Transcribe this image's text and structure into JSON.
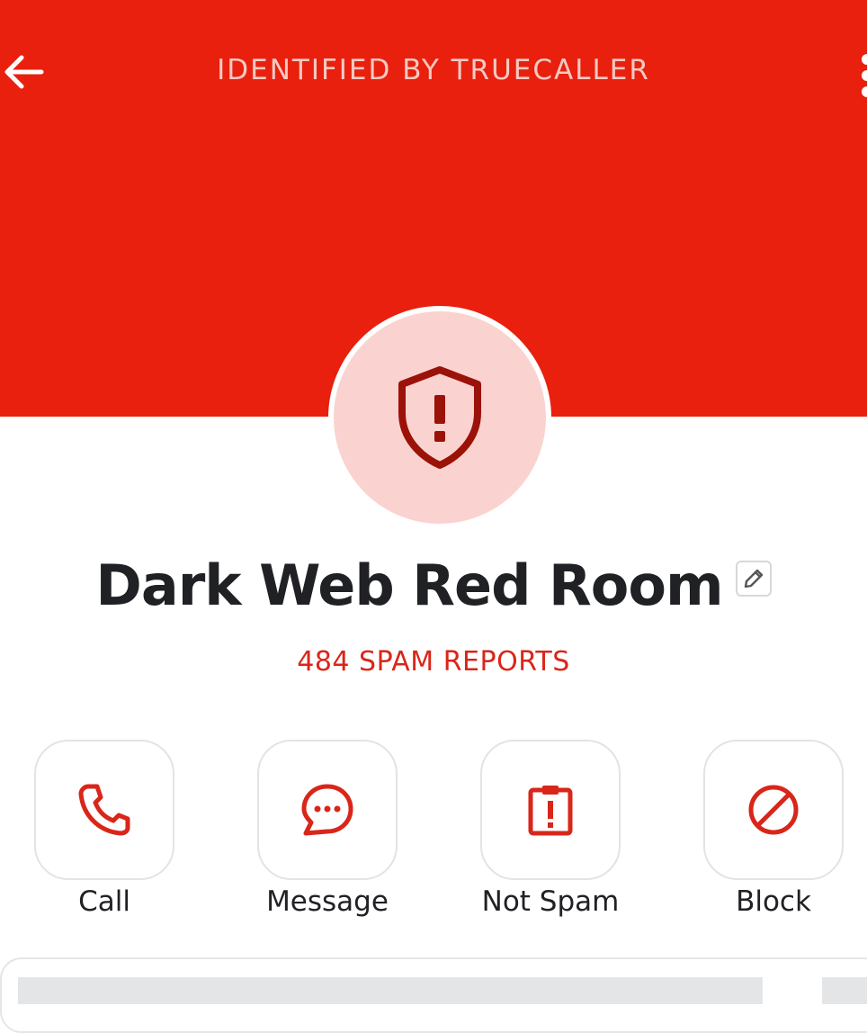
{
  "header": {
    "title": "IDENTIFIED BY TRUECALLER",
    "background_color": "#e8200d",
    "back_icon": "arrow-left-icon",
    "more_icon": "more-vertical-icon"
  },
  "avatar": {
    "icon": "shield-alert-icon",
    "background_color": "#fad3d0",
    "icon_color": "#9b1208"
  },
  "contact": {
    "name": "Dark Web Red Room",
    "edit_icon": "pencil-icon",
    "spam_reports": "484 SPAM REPORTS",
    "spam_color": "#d9261a"
  },
  "actions": [
    {
      "label": "Call",
      "icon": "phone-icon"
    },
    {
      "label": "Message",
      "icon": "chat-bubble-icon"
    },
    {
      "label": "Not Spam",
      "icon": "clipboard-alert-icon"
    },
    {
      "label": "Block",
      "icon": "block-icon"
    }
  ]
}
